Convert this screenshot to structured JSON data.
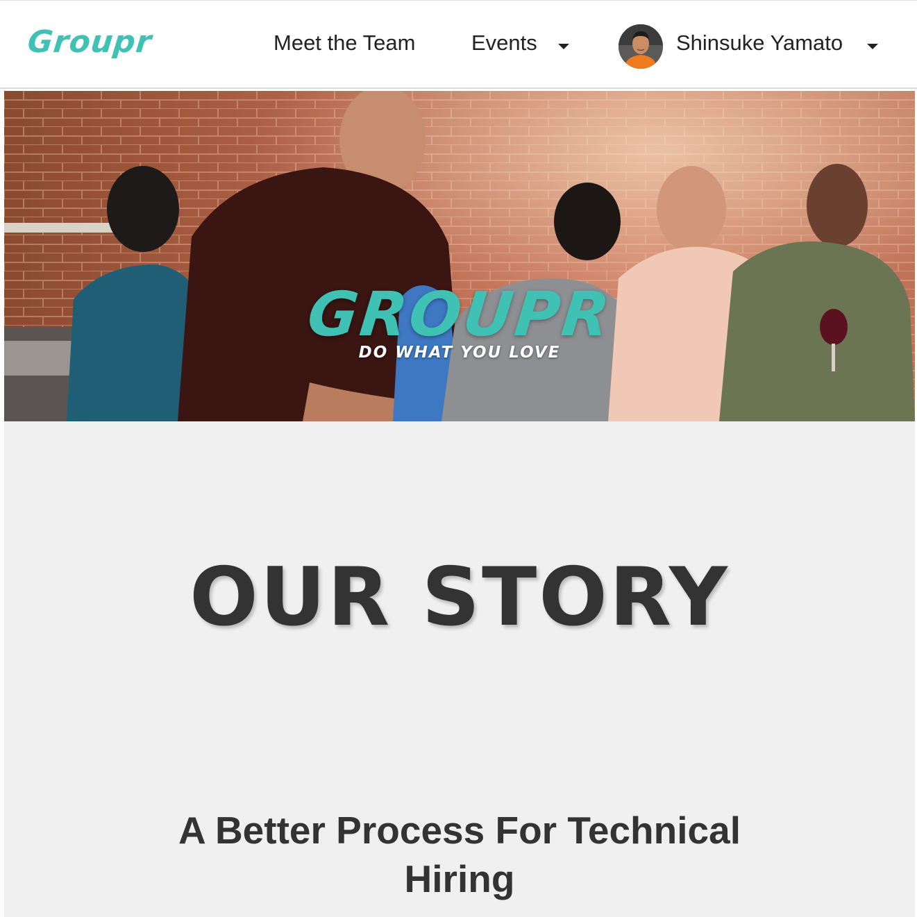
{
  "navbar": {
    "brand": "Groupr",
    "links": [
      {
        "label": "Meet the Team"
      },
      {
        "label": "Events"
      }
    ],
    "user": {
      "name": "Shinsuke Yamato"
    }
  },
  "hero": {
    "logo": "GROUPR",
    "tagline": "DO WHAT YOU LOVE"
  },
  "story": {
    "title": "OUR STORY",
    "subtitle": "A Better Process For Technical Hiring"
  },
  "colors": {
    "brand": "#3fc1b4",
    "text": "#333333",
    "section_bg": "#f0f0f0"
  }
}
